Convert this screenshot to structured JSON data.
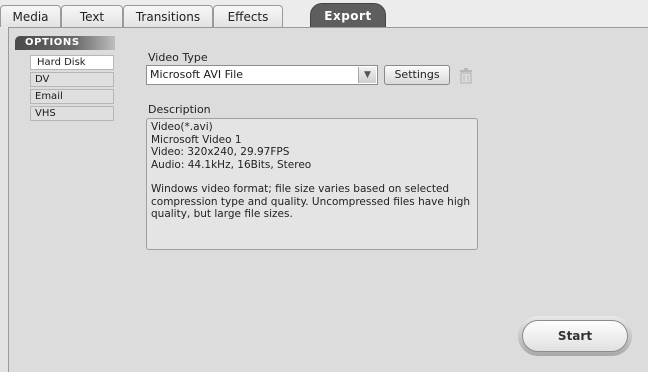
{
  "tabs": [
    {
      "label": "Media"
    },
    {
      "label": "Text"
    },
    {
      "label": "Transitions"
    },
    {
      "label": "Effects"
    },
    {
      "label": "Export",
      "active": true
    }
  ],
  "options": {
    "header": "OPTIONS",
    "items": [
      {
        "label": "Hard Disk",
        "selected": true
      },
      {
        "label": "DV"
      },
      {
        "label": "Email"
      },
      {
        "label": "VHS"
      }
    ]
  },
  "video_type": {
    "label": "Video Type",
    "value": "Microsoft AVI File",
    "settings_label": "Settings"
  },
  "description": {
    "label": "Description",
    "lines": [
      "Video(*.avi)",
      "Microsoft Video 1",
      "Video: 320x240, 29.97FPS",
      "Audio: 44.1kHz, 16Bits, Stereo"
    ],
    "paragraph": "Windows video format; file size varies based on selected compression type and quality. Uncompressed files have high quality, but large file sizes."
  },
  "start_label": "Start",
  "colors": {
    "active_tab": "#5e5e5e",
    "panel": "#dcdcdc"
  }
}
